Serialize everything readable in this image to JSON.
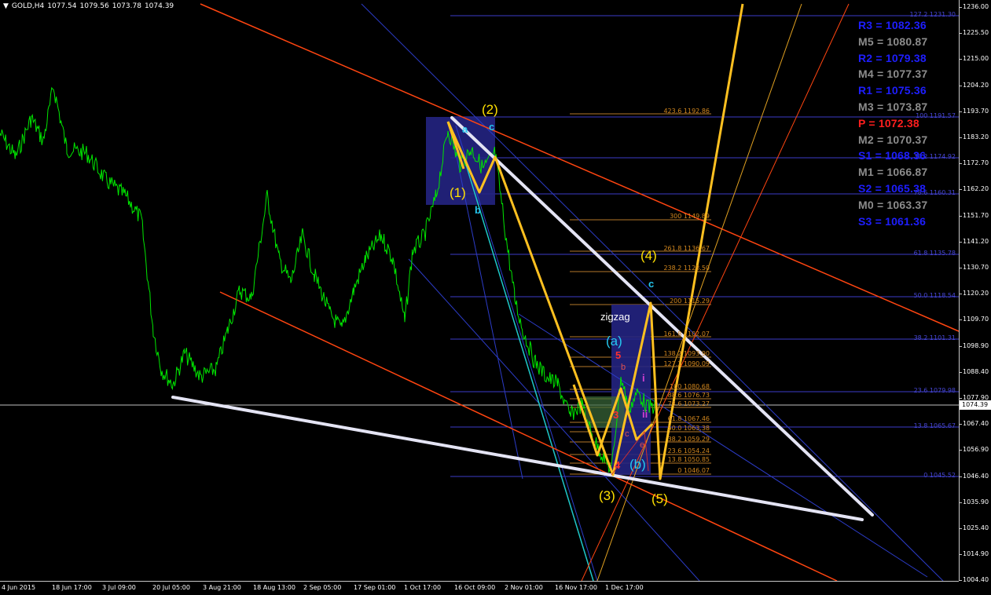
{
  "header": {
    "symbol": "GOLD,H4",
    "open": "1077.54",
    "high": "1079.56",
    "low": "1073.78",
    "close": "1074.39"
  },
  "current_price": "1074.39",
  "price_axis": [
    "1236.00",
    "1225.50",
    "1215.00",
    "1204.20",
    "1193.70",
    "1183.20",
    "1172.70",
    "1162.20",
    "1151.70",
    "1141.20",
    "1130.70",
    "1120.20",
    "1109.70",
    "1098.90",
    "1088.40",
    "1077.90",
    "1067.40",
    "1056.90",
    "1046.40",
    "1035.90",
    "1025.40",
    "1014.90",
    "1004.40"
  ],
  "time_axis": [
    "4 Jun 2015",
    "18 Jun 17:00",
    "3 Jul 09:00",
    "20 Jul 05:00",
    "3 Aug 21:00",
    "18 Aug 13:00",
    "2 Sep 05:00",
    "17 Sep 01:00",
    "1 Oct 17:00",
    "16 Oct 09:00",
    "2 Nov 01:00",
    "16 Nov 17:00",
    "1 Dec 17:00"
  ],
  "pivots": [
    {
      "label": "R3 = 1082.36",
      "color": "#1e1eff"
    },
    {
      "label": "M5 = 1080.87",
      "color": "#8c8c8c"
    },
    {
      "label": "R2 = 1079.38",
      "color": "#1e1eff"
    },
    {
      "label": "M4 = 1077.37",
      "color": "#8c8c8c"
    },
    {
      "label": "R1 = 1075.36",
      "color": "#1e1eff"
    },
    {
      "label": "M3 = 1073.87",
      "color": "#8c8c8c"
    },
    {
      "label": "P   = 1072.38",
      "color": "#ff1e1e"
    },
    {
      "label": "M2 = 1070.37",
      "color": "#8c8c8c"
    },
    {
      "label": "S1 = 1068.36",
      "color": "#1e1eff"
    },
    {
      "label": "M1 = 1066.87",
      "color": "#8c8c8c"
    },
    {
      "label": "S2 = 1065.38",
      "color": "#1e1eff"
    },
    {
      "label": "M0 = 1063.37",
      "color": "#8c8c8c"
    },
    {
      "label": "S3 = 1061.36",
      "color": "#1e1eff"
    }
  ],
  "fibo_retracement": [
    "127.2 1231.30",
    "100 1191.57",
    "38.2 1174.92",
    "78.6 1160.31",
    "61.8 1135.78",
    "50.0 1118.54",
    "38.2 1101.31",
    "23.6 1079.98",
    "13.8 1065.67",
    "0 1045.52"
  ],
  "fibo_expansion": [
    "423.6 1192.86",
    "300 1149.89",
    "261.8 1136.67",
    "238.2 1128.50",
    "200 1115.29",
    "161.8 1102.07",
    "138.2 1093.90",
    "127.2 1090.09",
    "100 1080.68",
    "88.6 1076.73",
    "78.6 1073.27",
    "61.8 1067.46",
    "50.0 1063.38",
    "38.2 1059.29",
    "23.6 1054.24",
    "13.8 1050.85",
    "0 1046.07"
  ],
  "wave_labels": {
    "w1": "(1)",
    "w2": "(2)",
    "w3": "(3)",
    "w4": "(4)",
    "w5": "(5)",
    "wa": "(a)",
    "wb": "(b)",
    "b1": "b",
    "c1": "c",
    "c2": "c",
    "a1": "a",
    "zigzag": "zigzag",
    "n5": "5",
    "n4": "4",
    "n3": "3",
    "i": "i",
    "ii": "ii",
    "e": "e",
    "c3": "c",
    "b3": "b"
  },
  "colors": {
    "price": "#00e600",
    "wave": "#ffc020",
    "channel": "#ff4510",
    "trendline": "#e8e8f8",
    "fibo_blue": "#3c3cc8",
    "fibo_orange": "#d2871e",
    "subwave": "#25c8f0"
  }
}
